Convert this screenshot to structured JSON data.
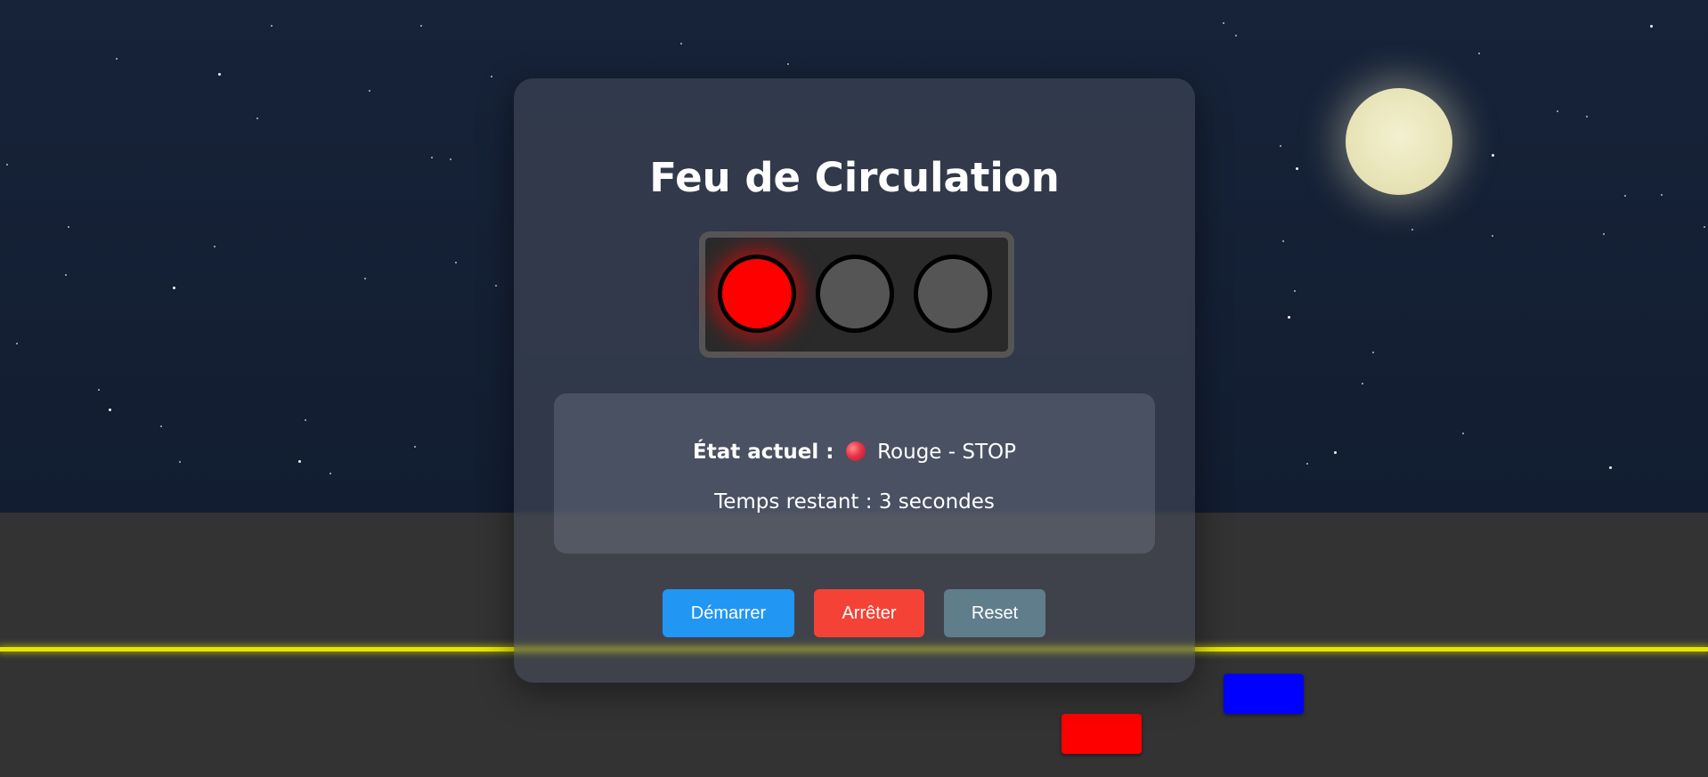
{
  "app": {
    "title": "Feu de Circulation"
  },
  "traffic_light": {
    "state": "red",
    "lamps": [
      {
        "name": "red",
        "active": true
      },
      {
        "name": "yellow",
        "active": false
      },
      {
        "name": "green",
        "active": false
      }
    ]
  },
  "status": {
    "label": "État actuel :",
    "value": "Rouge - STOP",
    "time_remaining": "Temps restant : 3 secondes"
  },
  "buttons": {
    "start_label": "Démarrer",
    "stop_label": "Arrêter",
    "reset_label": "Reset"
  },
  "colors": {
    "sky": "#152036",
    "road": "#333333",
    "road_line": "#e6e600",
    "lamp_red": "#ff0000",
    "lamp_off": "#555555",
    "btn_start": "#2196f3",
    "btn_stop": "#f44336",
    "btn_reset": "#607d8b",
    "car_blue": "#0000ff",
    "car_red": "#ff0000",
    "moon": "#efeccb"
  },
  "icons": {
    "status_dot": "red-circle-icon",
    "moon": "moon-icon"
  }
}
